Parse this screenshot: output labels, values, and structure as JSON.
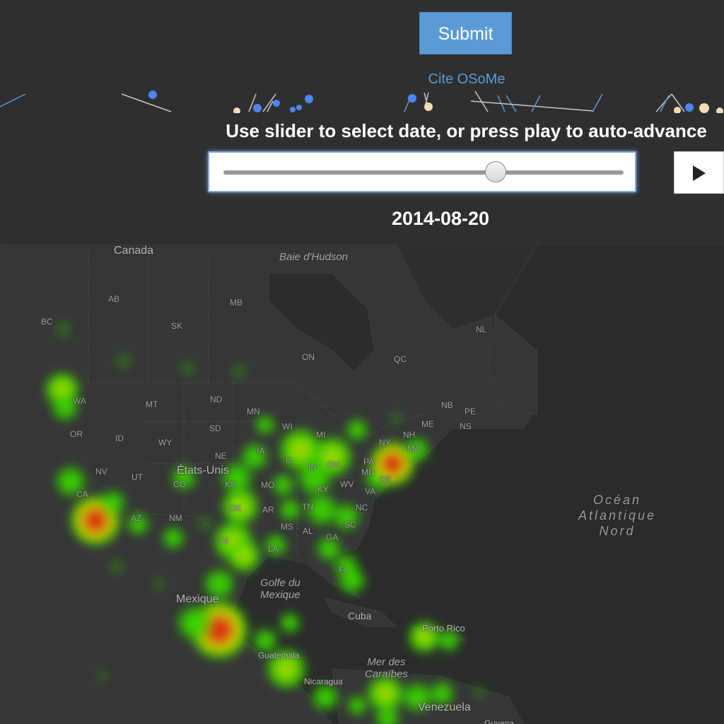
{
  "controls": {
    "submit_label": "Submit",
    "cite_label": "Cite OSoMe",
    "slider_instruction": "Use slider to select date, or press play to auto-advance",
    "slider_position": 0.68,
    "date": "2014-08-20",
    "play_icon": "play-icon"
  },
  "colors": {
    "background": "#2f2f2f",
    "accent": "#5b9bd5",
    "map_land": "#353535",
    "map_water": "#2b2b2b",
    "heat_low": "#33dd00",
    "heat_mid": "#d8d800",
    "heat_high": "#e01010"
  },
  "map": {
    "countries": [
      "Canada",
      "États-Unis",
      "Mexique",
      "Cuba",
      "Guatemala",
      "Nicaragua",
      "Venezuela",
      "Guyana",
      "Porto Rico"
    ],
    "water": [
      {
        "key": "hudson",
        "label": "Baie d'Hudson"
      },
      {
        "key": "gulf",
        "line1": "Golfe du",
        "line2": "Mexique"
      },
      {
        "key": "carib",
        "line1": "Mer des",
        "line2": "Caraïbes"
      },
      {
        "key": "atlantic",
        "line1": "Océan",
        "line2": "Atlantique",
        "line3": "Nord"
      }
    ],
    "regions": [
      "AB",
      "BC",
      "MB",
      "SK",
      "ON",
      "QC",
      "NL",
      "NB",
      "PE",
      "NS",
      "ME",
      "NH",
      "MA",
      "NY",
      "PA",
      "MD",
      "DE",
      "VA",
      "WV",
      "OH",
      "MI",
      "IN",
      "IL",
      "WI",
      "MN",
      "IA",
      "MO",
      "KY",
      "TN",
      "NC",
      "SC",
      "GA",
      "AL",
      "MS",
      "AR",
      "LA",
      "FL",
      "TX",
      "OK",
      "KS",
      "NE",
      "SD",
      "ND",
      "MT",
      "WY",
      "CO",
      "NM",
      "AZ",
      "UT",
      "NV",
      "CA",
      "OR",
      "ID",
      "WA"
    ]
  }
}
